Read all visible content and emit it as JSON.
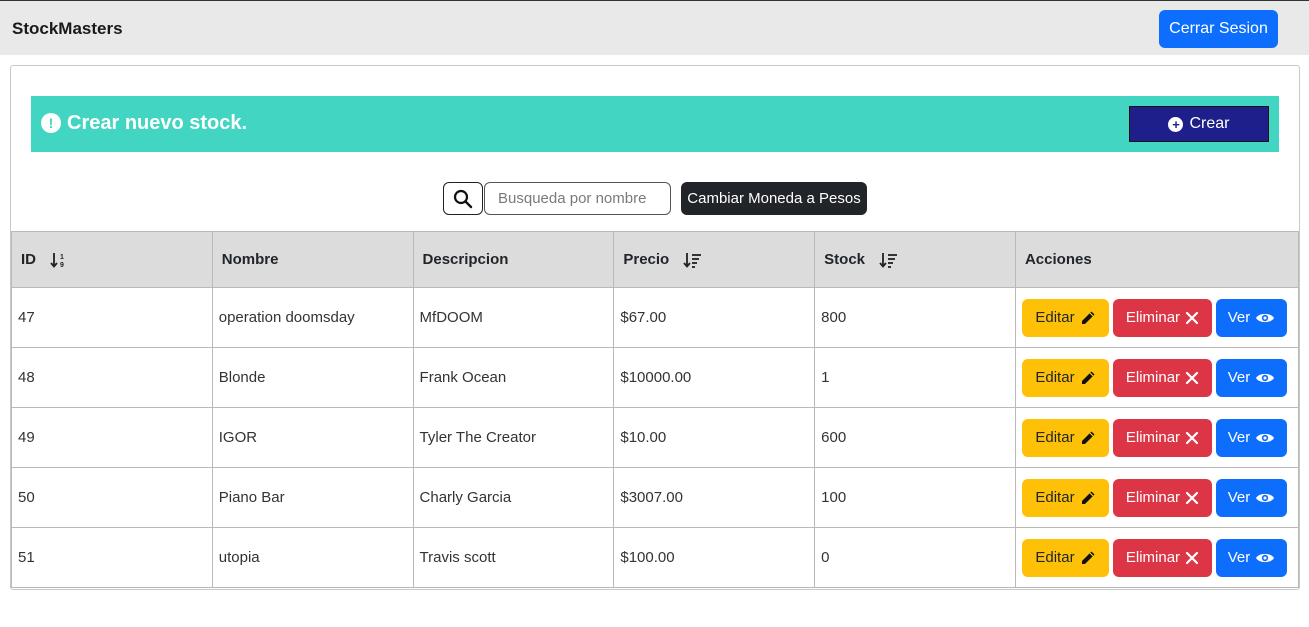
{
  "navbar": {
    "brand": "StockMasters",
    "logout_label": "Cerrar Sesion"
  },
  "banner": {
    "title": "Crear nuevo stock.",
    "create_label": "Crear",
    "icon": "exclamation-circle-icon",
    "color": "#42d6c2"
  },
  "search": {
    "placeholder": "Busqueda por nombre",
    "value": "",
    "currency_label": "Cambiar Moneda a Pesos"
  },
  "table": {
    "headers": {
      "id": "ID",
      "nombre": "Nombre",
      "descripcion": "Descripcion",
      "precio": "Precio",
      "stock": "Stock",
      "acciones": "Acciones"
    },
    "rows": [
      {
        "id": "47",
        "nombre": "operation doomsday",
        "descripcion": "MfDOOM",
        "precio": "$67.00",
        "stock": "800"
      },
      {
        "id": "48",
        "nombre": "Blonde",
        "descripcion": "Frank Ocean",
        "precio": "$10000.00",
        "stock": "1"
      },
      {
        "id": "49",
        "nombre": "IGOR",
        "descripcion": "Tyler The Creator",
        "precio": "$10.00",
        "stock": "600"
      },
      {
        "id": "50",
        "nombre": "Piano Bar",
        "descripcion": "Charly Garcia",
        "precio": "$3007.00",
        "stock": "100"
      },
      {
        "id": "51",
        "nombre": "utopia",
        "descripcion": "Travis scott",
        "precio": "$100.00",
        "stock": "0"
      }
    ],
    "actions": {
      "edit_label": "Editar",
      "delete_label": "Eliminar",
      "view_label": "Ver"
    }
  },
  "colors": {
    "primary": "#0d6efd",
    "warning": "#ffc107",
    "danger": "#dc3545",
    "dark": "#212529",
    "navy": "#1f1f8c"
  }
}
